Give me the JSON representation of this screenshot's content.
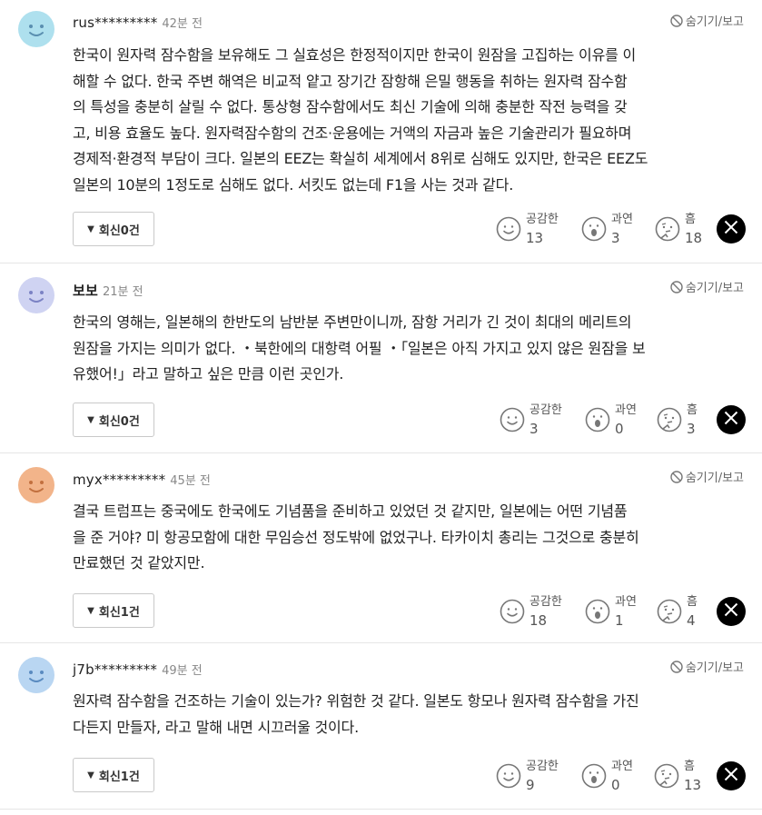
{
  "hide_label": "숨기기/보고",
  "reaction_labels": {
    "empathy": "공감한",
    "indeed": "과연",
    "hmm": "흠"
  },
  "colors": {
    "avatar_blue": "#aee0ee",
    "avatar_lavender": "#cfd3f2",
    "avatar_peach": "#f2b48a",
    "avatar_sky": "#b9d6f2"
  },
  "comments": [
    {
      "user": "rus*********",
      "time": "42분 전",
      "avatar_color": "#aee0ee",
      "lines": [
        "한국이 원자력 잠수함을 보유해도 그 실효성은 한정적이지만 한국이 원잠을 고집하는 이유를 이",
        "해할 수 없다. 한국 주변 해역은 비교적 얕고 장기간 잠항해 은밀 행동을 취하는 원자력 잠수함",
        "의 특성을 충분히 살릴 수 없다. 통상형 잠수함에서도 최신 기술에 의해 충분한 작전 능력을 갖",
        "고, 비용 효율도 높다. 원자력잠수함의 건조·운용에는 거액의 자금과 높은 기술관리가 필요하며",
        "경제적·환경적 부담이 크다. 일본의 EEZ는 확실히 세계에서 8위로 심해도 있지만, 한국은 EEZ도",
        "일본의 10분의 1정도로 심해도 없다. 서킷도 없는데 F1을 사는 것과 같다."
      ],
      "replies": "회신0건",
      "empathy": "13",
      "indeed": "3",
      "hmm": "18"
    },
    {
      "user": "보보",
      "time": "21분 전",
      "avatar_color": "#cfd3f2",
      "lines": [
        "한국의 영해는, 일본해의 한반도의 남반분 주변만이니까, 잠항 거리가 긴 것이 최대의 메리트의",
        "원잠을 가지는 의미가 없다. ・북한에의 대항력 어필 ・「일본은 아직 가지고 있지 않은 원잠을 보",
        "유했어!」라고 말하고 싶은 만큼 이런 곳인가."
      ],
      "replies": "회신0건",
      "empathy": "3",
      "indeed": "0",
      "hmm": "3"
    },
    {
      "user": "myx*********",
      "time": "45분 전",
      "avatar_color": "#f2b48a",
      "lines": [
        "결국 트럼프는 중국에도 한국에도 기념품을 준비하고 있었던 것 같지만, 일본에는 어떤 기념품",
        "을 준 거야? 미 항공모함에 대한 무임승선 정도밖에 없었구나. 타카이치 총리는 그것으로 충분히",
        "만료했던 것 같았지만."
      ],
      "replies": "회신1건",
      "empathy": "18",
      "indeed": "1",
      "hmm": "4"
    },
    {
      "user": "j7b*********",
      "time": "49분 전",
      "avatar_color": "#b9d6f2",
      "lines": [
        "원자력 잠수함을 건조하는 기술이 있는가? 위험한 것 같다. 일본도 항모나 원자력 잠수함을 가진",
        "다든지 만들자, 라고 말해 내면 시끄러울 것이다."
      ],
      "replies": "회신1건",
      "empathy": "9",
      "indeed": "0",
      "hmm": "13"
    }
  ]
}
